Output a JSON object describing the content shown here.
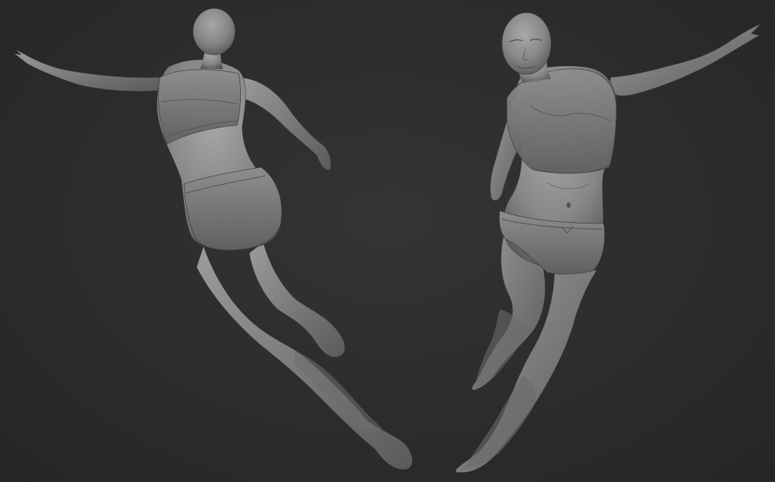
{
  "scene": {
    "background_color": "#2a2a2a",
    "figure_color": "#8a8a8a",
    "figure_shadow_color": "#4a4a4a",
    "figures": [
      {
        "name": "figure-back-view",
        "view": "back"
      },
      {
        "name": "figure-front-view",
        "view": "front"
      }
    ]
  }
}
